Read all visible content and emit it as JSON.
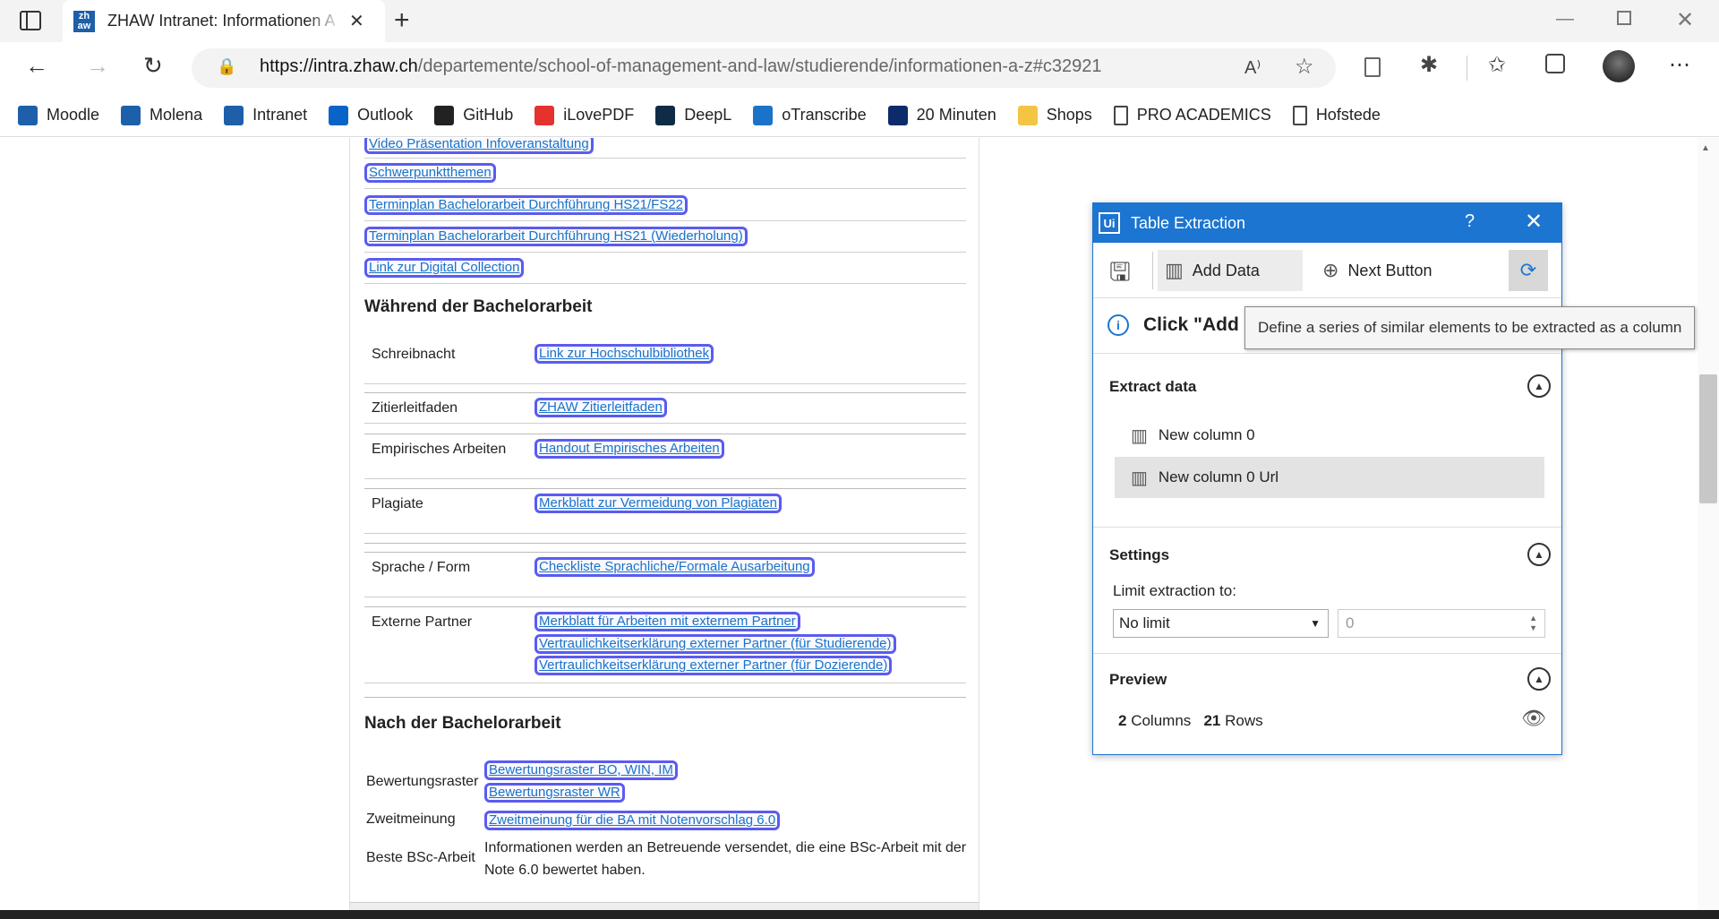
{
  "browser": {
    "tab_title": "ZHAW Intranet: Informationen A",
    "tab_favicon": "zh aw",
    "url_host": "https://intra.zhaw.ch",
    "url_path": "/departemente/school-of-management-and-law/studierende/informationen-a-z#c32921",
    "bookmarks": [
      {
        "label": "Moodle",
        "icon": "moodle-icon",
        "color": "#1e5fa9"
      },
      {
        "label": "Molena",
        "icon": "zhaw-icon",
        "color": "#1e5fa9"
      },
      {
        "label": "Intranet",
        "icon": "zhaw-icon",
        "color": "#1e5fa9"
      },
      {
        "label": "Outlook",
        "icon": "outlook-icon",
        "color": "#0a64c8"
      },
      {
        "label": "GitHub",
        "icon": "github-icon",
        "color": "#222222"
      },
      {
        "label": "iLovePDF",
        "icon": "heart-icon",
        "color": "#e5322d"
      },
      {
        "label": "DeepL",
        "icon": "deepl-icon",
        "color": "#0f2b46"
      },
      {
        "label": "oTranscribe",
        "icon": "otranscribe-icon",
        "color": "#1a73c8"
      },
      {
        "label": "20 Minuten",
        "icon": "twenty-min-icon",
        "color": "#0d2a6b"
      },
      {
        "label": "Shops",
        "icon": "folder-icon",
        "color": "#f4c542"
      },
      {
        "label": "PRO ACADEMICS",
        "icon": "page-icon",
        "color": "#ffffff"
      },
      {
        "label": "Hofstede",
        "icon": "page-icon",
        "color": "#ffffff"
      }
    ]
  },
  "content": {
    "top_links": [
      "Video Präsentation Infoveranstaltung",
      "Schwerpunktthemen",
      "Terminplan Bachelorarbeit Durchführung HS21/FS22",
      "Terminplan Bachelorarbeit Durchführung HS21 (Wiederholung)",
      "Link zur Digital Collection"
    ],
    "heading_during": "Während der Bachelorarbeit",
    "during_rows": [
      {
        "label": "Schreibnacht",
        "links": [
          "Link zur Hochschulbibliothek"
        ]
      },
      {
        "label": "Zitierleitfaden",
        "links": [
          "ZHAW Zitierleitfaden"
        ]
      },
      {
        "label": "Empirisches Arbeiten",
        "links": [
          "Handout Empirisches Arbeiten"
        ]
      },
      {
        "label": "Plagiate",
        "links": [
          "Merkblatt zur Vermeidung von Plagiaten"
        ]
      },
      {
        "label": "Sprache / Form",
        "links": [
          "Checkliste Sprachliche/Formale Ausarbeitung"
        ]
      },
      {
        "label": "Externe Partner",
        "links": [
          "Merkblatt für Arbeiten mit externem Partner",
          "Vertraulichkeitserklärung externer Partner (für Studierende)",
          "Vertraulichkeitserklärung externer Partner (für Dozierende)"
        ]
      }
    ],
    "heading_after": "Nach der Bachelorarbeit",
    "after_rows": [
      {
        "label": "Bewertungsraster",
        "links": [
          "Bewertungsraster BO, WIN, IM",
          "Bewertungsraster WR"
        ]
      },
      {
        "label": "Zweitmeinung",
        "links": [
          "Zweitmeinung für die BA mit Notenvorschlag 6.0"
        ]
      },
      {
        "label": "Beste BSc-Arbeit",
        "text": "Informationen werden an Betreuende versendet, die eine BSc-Arbeit mit der Note 6.0 bewertet haben."
      }
    ]
  },
  "panel": {
    "logo": "Ui",
    "title": "Table Extraction",
    "help": "?",
    "add_data": "Add Data",
    "next_button": "Next Button",
    "info_text": "Click \"Add D",
    "extract_header": "Extract data",
    "columns": [
      "New column 0",
      "New column 0 Url"
    ],
    "settings_header": "Settings",
    "limit_label": "Limit extraction to:",
    "limit_value": "No limit",
    "limit_number": "0",
    "preview_header": "Preview",
    "preview_columns": "2",
    "preview_columns_label": "Columns",
    "preview_rows": "21",
    "preview_rows_label": "Rows",
    "accent": "#1c75d0"
  },
  "tooltip": "Define a series of similar elements to be extracted as a column"
}
